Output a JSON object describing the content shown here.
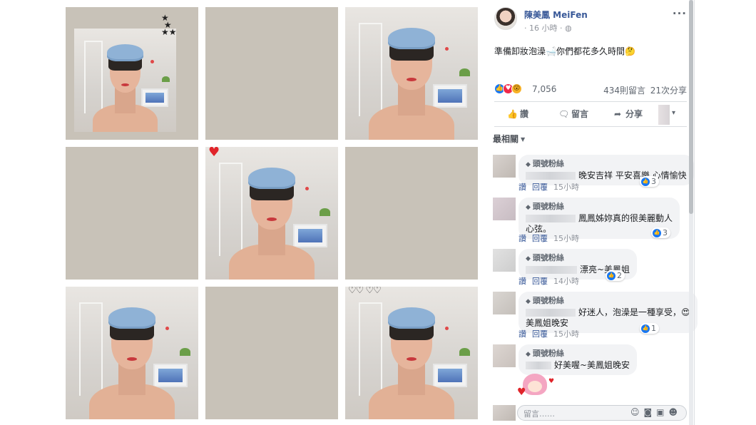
{
  "post": {
    "page_name": "陳美鳳 MeiFen",
    "time": "16 小時",
    "privacy_icon": "globe-icon",
    "text": "準備卸妝泡澡🛁你們都花多久時間🤔",
    "reaction_count": "7,056",
    "comments_count": "434則留言",
    "shares_count": "21次分享"
  },
  "actions": {
    "like": "讚",
    "comment": "留言",
    "share": "分享"
  },
  "filter": {
    "label": "最相關"
  },
  "comments": [
    {
      "badge": "頭號粉絲",
      "text": "晚安吉祥 平安喜樂 心情愉快",
      "like": "讚",
      "reply": "回覆",
      "time": "15小時",
      "reactions": "3"
    },
    {
      "badge": "頭號粉絲",
      "text": "鳳鳳姊妳真的很美麗動人",
      "text2": "心弦。",
      "like": "讚",
      "reply": "回覆",
      "time": "15小時",
      "reactions": "3"
    },
    {
      "badge": "頭號粉絲",
      "text": "漂亮~美鳳姐",
      "like": "讚",
      "reply": "回覆",
      "time": "14小時",
      "reactions": "2"
    },
    {
      "badge": "頭號粉絲",
      "text": "好迷人，泡澡是一種享受，😍",
      "text2": "美鳳姐晚安",
      "like": "讚",
      "reply": "回覆",
      "time": "15小時",
      "reactions": "1"
    },
    {
      "badge": "頭號粉絲",
      "text": "好美喔~美鳳姐晚安"
    }
  ],
  "composer": {
    "placeholder": "留言……"
  },
  "colors": {
    "link": "#385898",
    "like_blue": "#1877f2",
    "grid_bg": "#c8c2b8"
  }
}
